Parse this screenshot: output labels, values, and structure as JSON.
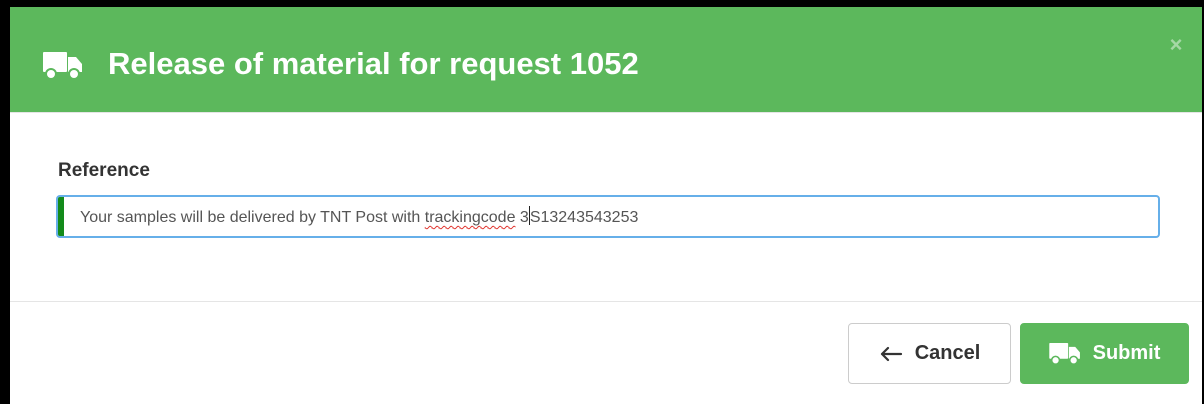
{
  "modal": {
    "title": "Release of material for request 1052",
    "title_icon": "truck-icon",
    "close_icon": "close-icon",
    "close_glyph": "×"
  },
  "reference": {
    "label": "Reference",
    "value_part1": "Your samples will be delivered by TNT Post with ",
    "value_misspelled": "trackingcode",
    "value_part2": " 3",
    "value_part3": "S13243543253"
  },
  "footer": {
    "cancel_label": "Cancel",
    "cancel_icon": "arrow-left-icon",
    "submit_label": "Submit",
    "submit_icon": "truck-icon"
  },
  "colors": {
    "header": "#5cb85c",
    "submit": "#5cb85c",
    "input_accent": "#138b1b",
    "input_focus_border": "#66afe9"
  }
}
